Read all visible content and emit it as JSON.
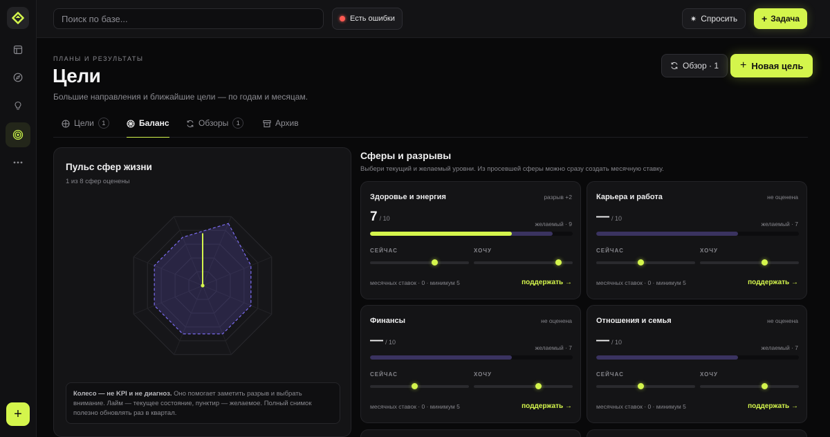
{
  "sidebar": {
    "logo_icon": "app-logo",
    "items": [
      {
        "icon": "layout-icon",
        "active": false
      },
      {
        "icon": "compass-icon",
        "active": false
      },
      {
        "icon": "lightbulb-icon",
        "active": false
      },
      {
        "icon": "target-icon",
        "active": true
      },
      {
        "icon": "more-icon",
        "active": false
      }
    ],
    "add_label": "+"
  },
  "topbar": {
    "search_placeholder": "Поиск по базе...",
    "errors_label": "Есть ошибки",
    "ask_label": "Спросить",
    "task_label": "Задача"
  },
  "header": {
    "eyebrow": "ПЛАНЫ И РЕЗУЛЬТАТЫ",
    "title": "Цели",
    "subtitle": "Большие направления и ближайшие цели — по годам и месяцам.",
    "overview_label": "Обзор · 1",
    "new_goal_label": "Новая цель"
  },
  "tabs": [
    {
      "label": "Цели",
      "badge": "1",
      "active": false
    },
    {
      "label": "Баланс",
      "badge": "",
      "active": true
    },
    {
      "label": "Обзоры",
      "badge": "1",
      "active": false
    },
    {
      "label": "Архив",
      "badge": "",
      "active": false
    }
  ],
  "pulse": {
    "title": "Пульс сфер жизни",
    "subtitle": "1 из 8 сфер оценены",
    "note_bold": "Колесо — не KPI и не диагноз.",
    "note_text": " Оно помогает заметить разрыв и выбрать внимание. Лайм — текущее состояние, пунктир — желаемое. Полный снимок полезно обновлять раз в квартал.",
    "current_value": 7,
    "max_value": 10
  },
  "spheres": {
    "title": "Сферы и разрывы",
    "subtitle": "Выбери текущий и желаемый уровни. Из просевшей сферы можно сразу создать месячную ставку.",
    "now_label": "СЕЙЧАС",
    "want_label": "ХОЧУ",
    "support_label": "поддержать →",
    "cards": [
      {
        "name": "Здоровье и энергия",
        "gap": "разрыв +2",
        "score": "7",
        "of": "/ 10",
        "desired": "желаемый · 9",
        "stakes": "месячных ставок · 0 · минимум 5",
        "current_fraction": 0.7,
        "desired_fraction": 0.9,
        "now_slider": 0.65,
        "want_slider": 0.85
      },
      {
        "name": "Карьера и работа",
        "gap": "не оценена",
        "score": "—",
        "of": "/ 10",
        "desired": "желаемый · 7",
        "stakes": "месячных ставок · 0 · минимум 5",
        "current_fraction": 0,
        "desired_fraction": 0.7,
        "now_slider": 0.45,
        "want_slider": 0.65
      },
      {
        "name": "Финансы",
        "gap": "не оценена",
        "score": "—",
        "of": "/ 10",
        "desired": "желаемый · 7",
        "stakes": "месячных ставок · 0 · минимум 5",
        "current_fraction": 0,
        "desired_fraction": 0.7,
        "now_slider": 0.45,
        "want_slider": 0.65
      },
      {
        "name": "Отношения и семья",
        "gap": "не оценена",
        "score": "—",
        "of": "/ 10",
        "desired": "желаемый · 7",
        "stakes": "месячных ставок · 0 · минимум 5",
        "current_fraction": 0,
        "desired_fraction": 0.7,
        "now_slider": 0.45,
        "want_slider": 0.65
      }
    ]
  },
  "colors": {
    "accent": "#d4f54c",
    "desired": "#7b6cf0",
    "error": "#ff5a52"
  }
}
